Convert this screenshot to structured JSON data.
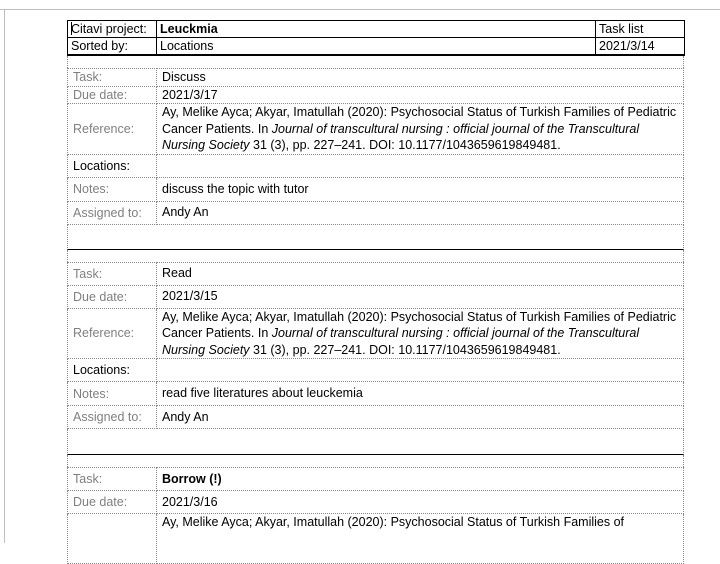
{
  "header": {
    "project_label": "Citavi project:",
    "project_name": "Leuckmia",
    "report_title": "Task list",
    "sorted_label": "Sorted by:",
    "sorted_value": "Locations",
    "report_date": "2021/3/14"
  },
  "labels": {
    "task": "Task:",
    "due": "Due date:",
    "reference": "Reference:",
    "locations": "Locations:",
    "notes": "Notes:",
    "assigned": "Assigned to:"
  },
  "reference": {
    "authors": "Ay, Melike Ayca; Akyar, Imatullah (2020): Psychosocial Status of Turkish Families of Pediatric Cancer Patients. In ",
    "journal": "Journal of transcultural nursing : official journal of the Transcultural Nursing Society",
    "rest": " 31 (3), pp. 227–241. DOI: 10.1177/1043659619849481."
  },
  "tasks": [
    {
      "name": "Discuss",
      "due": "2021/3/17",
      "locations": "",
      "notes": "discuss the topic with tutor",
      "assigned": "Andy An"
    },
    {
      "name": "Read",
      "due": "2021/3/15",
      "locations": "",
      "notes": "read five literatures about leuckemia",
      "assigned": "Andy An"
    },
    {
      "name": "Borrow (!)",
      "due": "2021/3/16"
    }
  ],
  "partial_reference_line": "Ay, Melike Ayca; Akyar, Imatullah (2020): Psychosocial Status of Turkish Families of"
}
